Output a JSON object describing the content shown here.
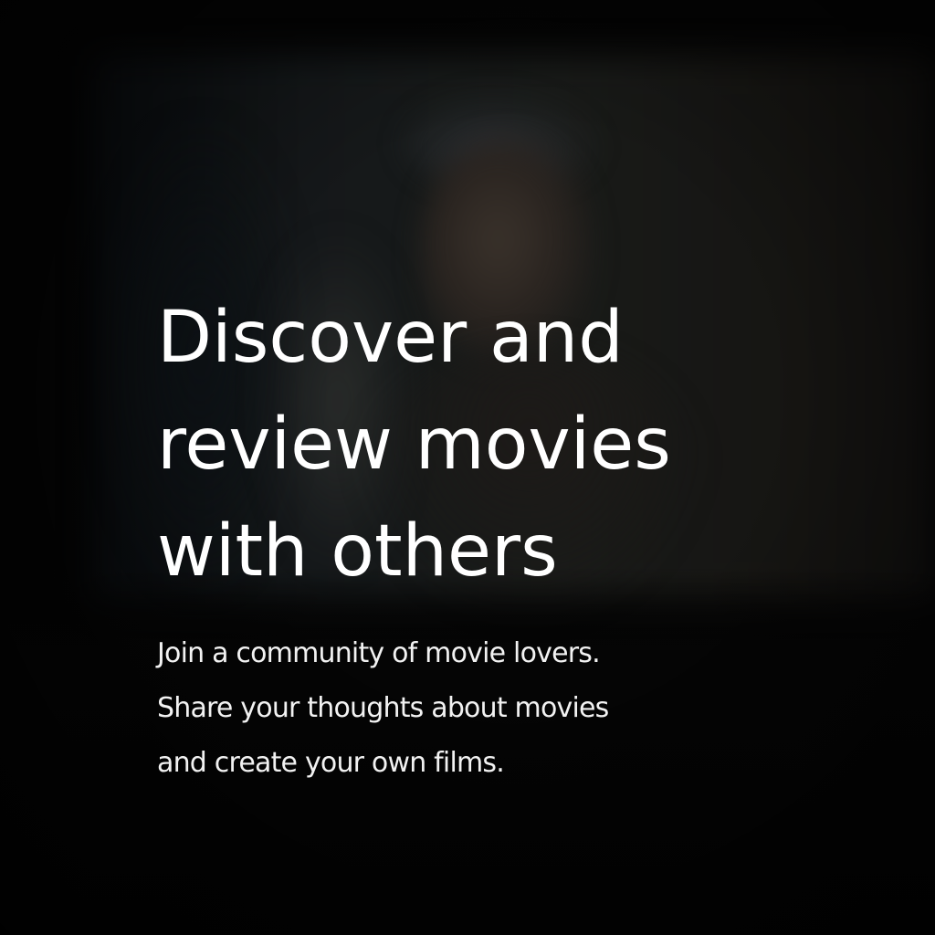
{
  "hero": {
    "headline_lines": [
      "Discover and",
      "review movies",
      "with others"
    ],
    "subtext_lines": [
      "Join a community of movie lovers.",
      "Share your thoughts about movies",
      "and create your own films."
    ]
  },
  "colors": {
    "background": "#040404",
    "text": "#ffffff"
  }
}
